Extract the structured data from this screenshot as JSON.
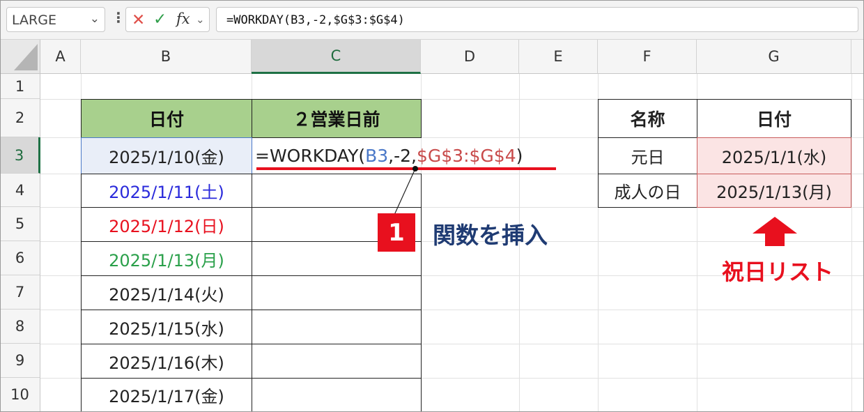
{
  "formula_bar": {
    "name_box": "LARGE",
    "name_box_arrow": "⌄",
    "more_icon": "⋮",
    "cancel_icon": "✕",
    "enter_icon": "✓",
    "fx_icon": "fx",
    "fx_arrow": "⌄",
    "formula": "=WORKDAY(B3,-2,$G$3:$G$4)"
  },
  "columns": [
    "A",
    "B",
    "C",
    "D",
    "E",
    "F",
    "G"
  ],
  "rows": [
    "1",
    "2",
    "3",
    "4",
    "5",
    "6",
    "7",
    "8",
    "9",
    "10"
  ],
  "main_table": {
    "header_date": "日付",
    "header_result": "２営業日前",
    "dates": [
      {
        "text": "2025/1/10(金)",
        "color": "#222222"
      },
      {
        "text": "2025/1/11(土)",
        "color": "#2a2adb"
      },
      {
        "text": "2025/1/12(日)",
        "color": "#e8101e"
      },
      {
        "text": "2025/1/13(月)",
        "color": "#2aa04a"
      },
      {
        "text": "2025/1/14(火)",
        "color": "#222222"
      },
      {
        "text": "2025/1/15(水)",
        "color": "#222222"
      },
      {
        "text": "2025/1/16(木)",
        "color": "#222222"
      },
      {
        "text": "2025/1/17(金)",
        "color": "#222222"
      }
    ],
    "edit_formula": {
      "p1": "=WORKDAY(",
      "ref1": "B3",
      "p2": ",-2,",
      "ref2": "$G$3:$G$4",
      "p3": ")"
    }
  },
  "holiday_table": {
    "header_name": "名称",
    "header_date": "日付",
    "rows": [
      {
        "name": "元日",
        "date": "2025/1/1(水)"
      },
      {
        "name": "成人の日",
        "date": "2025/1/13(月)"
      }
    ]
  },
  "annotations": {
    "step_number": "1",
    "step_text": "関数を挿入",
    "holiday_label": "祝日リスト"
  },
  "colors": {
    "header_fill": "#a8d08d",
    "accent_red": "#e8101e",
    "ref_blue": "#4a78c8",
    "ref_red": "#c84a4a",
    "excel_green": "#1e7145"
  }
}
